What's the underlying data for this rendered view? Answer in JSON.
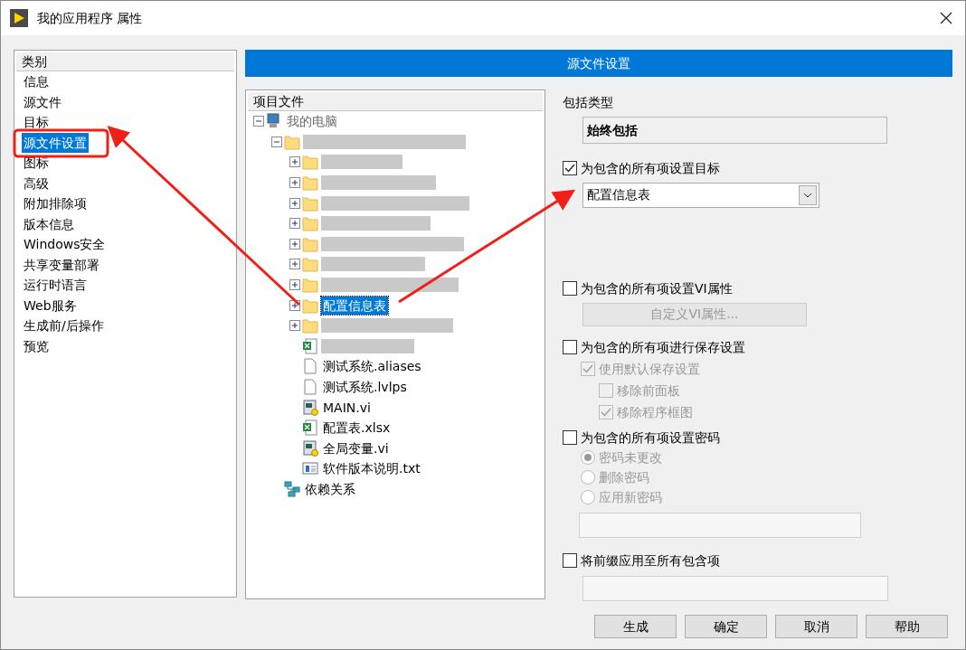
{
  "window": {
    "title": "我的应用程序 属性"
  },
  "category_list": {
    "heading": "类别",
    "items": [
      {
        "label": "信息",
        "selected": false
      },
      {
        "label": "源文件",
        "selected": false
      },
      {
        "label": "目标",
        "selected": false
      },
      {
        "label": "源文件设置",
        "selected": true
      },
      {
        "label": "图标",
        "selected": false
      },
      {
        "label": "高级",
        "selected": false
      },
      {
        "label": "附加排除项",
        "selected": false
      },
      {
        "label": "版本信息",
        "selected": false
      },
      {
        "label": "Windows安全",
        "selected": false
      },
      {
        "label": "共享变量部署",
        "selected": false
      },
      {
        "label": "运行时语言",
        "selected": false
      },
      {
        "label": "Web服务",
        "selected": false
      },
      {
        "label": "生成前/后操作",
        "selected": false
      },
      {
        "label": "预览",
        "selected": false
      }
    ]
  },
  "section_header": "源文件设置",
  "project_tree": {
    "heading": "项目文件",
    "items": [
      {
        "kind": "computer",
        "label": "我的电脑",
        "expanded": true,
        "selected": false,
        "children": [
          {
            "kind": "folder",
            "expanded": true,
            "selected": false,
            "children": [
              {
                "kind": "folder",
                "expanded": false,
                "selected": false
              },
              {
                "kind": "folder",
                "expanded": false,
                "selected": false
              },
              {
                "kind": "folder",
                "expanded": false,
                "selected": false
              },
              {
                "kind": "folder",
                "expanded": false,
                "selected": false
              },
              {
                "kind": "folder",
                "expanded": false,
                "selected": false
              },
              {
                "kind": "folder",
                "expanded": false,
                "selected": false
              },
              {
                "kind": "folder",
                "expanded": false,
                "selected": false
              },
              {
                "kind": "folder",
                "label": "配置信息表",
                "expanded": false,
                "selected": true
              },
              {
                "kind": "folder",
                "expanded": false,
                "selected": false
              },
              {
                "kind": "excel",
                "selected": false
              },
              {
                "kind": "file",
                "label": "测试系统.aliases",
                "selected": false
              },
              {
                "kind": "file",
                "label": "测试系统.lvlps",
                "selected": false
              },
              {
                "kind": "vi",
                "label": "MAIN.vi",
                "selected": false
              },
              {
                "kind": "excel",
                "label": "配置表.xlsx",
                "selected": false
              },
              {
                "kind": "vi",
                "label": "全局变量.vi",
                "selected": false
              },
              {
                "kind": "text",
                "label": "软件版本说明.txt",
                "selected": false
              }
            ]
          },
          {
            "kind": "dependencies",
            "label": "依赖关系",
            "selected": false
          }
        ]
      }
    ]
  },
  "settings": [
    {
      "kind": "label",
      "label": "包括类型"
    },
    {
      "kind": "readonly_field",
      "value": "始终包括"
    },
    {
      "kind": "checkbox",
      "label": "为包含的所有项设置目标",
      "checked": true,
      "disabled": false
    },
    {
      "kind": "dropdown",
      "value": "配置信息表"
    },
    {
      "kind": "checkbox",
      "label": "为包含的所有项设置VI属性",
      "checked": false,
      "disabled": false
    },
    {
      "kind": "button",
      "label": "自定义VI属性...",
      "disabled": true
    },
    {
      "kind": "checkbox",
      "label": "为包含的所有项进行保存设置",
      "checked": false,
      "disabled": false,
      "children": [
        {
          "kind": "checkbox",
          "label": "使用默认保存设置",
          "checked": true,
          "disabled": true,
          "children": [
            {
              "kind": "checkbox",
              "label": "移除前面板",
              "checked": false,
              "disabled": true
            },
            {
              "kind": "checkbox",
              "label": "移除程序框图",
              "checked": true,
              "disabled": true
            }
          ]
        }
      ]
    },
    {
      "kind": "checkbox",
      "label": "为包含的所有项设置密码",
      "checked": false,
      "disabled": false,
      "children": [
        {
          "kind": "radio",
          "label": "密码未更改",
          "selected": true,
          "disabled": true
        },
        {
          "kind": "radio",
          "label": "删除密码",
          "selected": false,
          "disabled": true
        },
        {
          "kind": "radio",
          "label": "应用新密码",
          "selected": false,
          "disabled": true
        },
        {
          "kind": "text_field",
          "disabled": true
        }
      ]
    },
    {
      "kind": "checkbox",
      "label": "将前缀应用至所有包含项",
      "checked": false,
      "disabled": false
    },
    {
      "kind": "text_field",
      "disabled": true
    }
  ],
  "buttons": [
    "生成",
    "确定",
    "取消",
    "帮助"
  ],
  "annotations": [
    {
      "kind": "highlight_box"
    },
    {
      "kind": "arrow"
    },
    {
      "kind": "arrow"
    }
  ]
}
